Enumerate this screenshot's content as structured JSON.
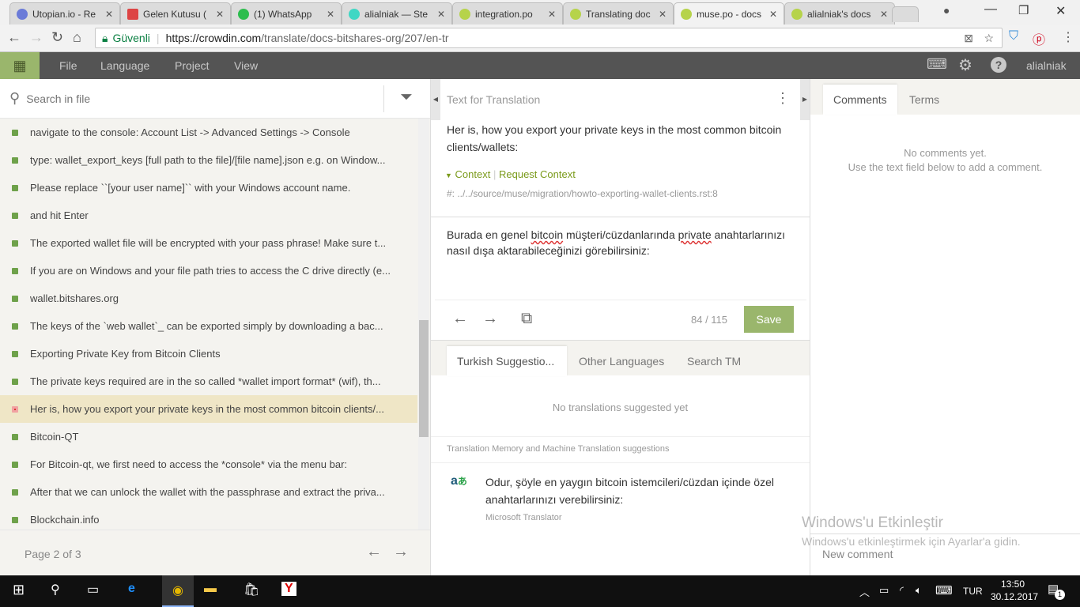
{
  "browser": {
    "tabs": [
      {
        "title": "Utopian.io - Re",
        "color": "#6b7bd8"
      },
      {
        "title": "Gelen Kutusu (",
        "color": "#d44"
      },
      {
        "title": "(1) WhatsApp",
        "color": "#2dbd4e"
      },
      {
        "title": "alialniak — Ste",
        "color": "#3fd7c4"
      },
      {
        "title": "integration.po",
        "color": "#b6d34a"
      },
      {
        "title": "Translating doc",
        "color": "#b6d34a"
      },
      {
        "title": "muse.po - docs",
        "color": "#b6d34a",
        "active": true
      },
      {
        "title": "alialniak's docs",
        "color": "#b6d34a"
      }
    ],
    "secure_label": "Güvenli",
    "url_host": "https://crowdin.com",
    "url_path": "/translate/docs-bitshares-org/207/en-tr"
  },
  "appnav": {
    "menu": [
      "File",
      "Language",
      "Project",
      "View"
    ],
    "user": "alialniak"
  },
  "left": {
    "search_placeholder": "Search in file",
    "items": [
      "navigate to the console: Account List -> Advanced Settings -> Console",
      "type: wallet_export_keys [full path to the file]/[file name].json e.g. on Window...",
      "Please replace ``[your user name]`` with your Windows account name.",
      "and hit Enter",
      "The exported wallet file will be encrypted with your pass phrase! Make sure t...",
      "If you are on Windows and your file path tries to access the C drive directly (e...",
      "wallet.bitshares.org",
      "The keys of the `web wallet`_ can be exported simply by downloading a bac...",
      "Exporting Private Key from Bitcoin Clients",
      "The private keys required are in the so called *wallet import format* (wif), th...",
      "Her is, how you export your private keys in the most common bitcoin clients/...",
      "Bitcoin-QT",
      "For Bitcoin-qt, we first need to access the *console* via the menu bar:",
      "After that we can unlock the wallet with the passphrase and extract the priva...",
      "Blockchain.info"
    ],
    "selected_index": 10,
    "page": "Page 2 of 3"
  },
  "source": {
    "header": "Text for Translation",
    "text": "Her is, how you export your private keys in the most common bitcoin clients/wallets:",
    "context_label": "Context",
    "request_context": "Request Context",
    "context_path": "#: ../../source/muse/migration/howto-exporting-wallet-clients.rst:8"
  },
  "translation": {
    "w1": "Burada en genel ",
    "w2": "bitcoin",
    " w3": "",
    "w3": " müşteri/cüzdanlarında ",
    "w4": "private",
    "w5": " anahtarlarınızı nasıl dışa aktarabileceğinizi görebilirsiniz:",
    "counter": "84 / 115",
    "save": "Save"
  },
  "suggestions": {
    "tabs": [
      "Turkish Suggestio...",
      "Other Languages",
      "Search TM"
    ],
    "empty": "No translations suggested yet",
    "section": "Translation Memory and Machine Translation suggestions",
    "mt_text": "Odur, şöyle en yaygın bitcoin istemcileri/cüzdan içinde özel anahtarlarınızı verebilirsiniz:",
    "mt_source": "Microsoft Translator"
  },
  "comments": {
    "tabs": [
      "Comments",
      "Terms"
    ],
    "empty1": "No comments yet.",
    "empty2": "Use the text field below to add a comment.",
    "new_comment": "New comment"
  },
  "watermark": {
    "title": "Windows'u Etkinleştir",
    "sub": "Windows'u etkinleştirmek için Ayarlar'a gidin."
  },
  "taskbar": {
    "lang": "TUR",
    "time": "13:50",
    "date": "30.12.2017",
    "notif": "1"
  },
  "colors": {
    "accent": "#9ab66c",
    "nav": "#545454",
    "context": "#7a9a1a"
  }
}
